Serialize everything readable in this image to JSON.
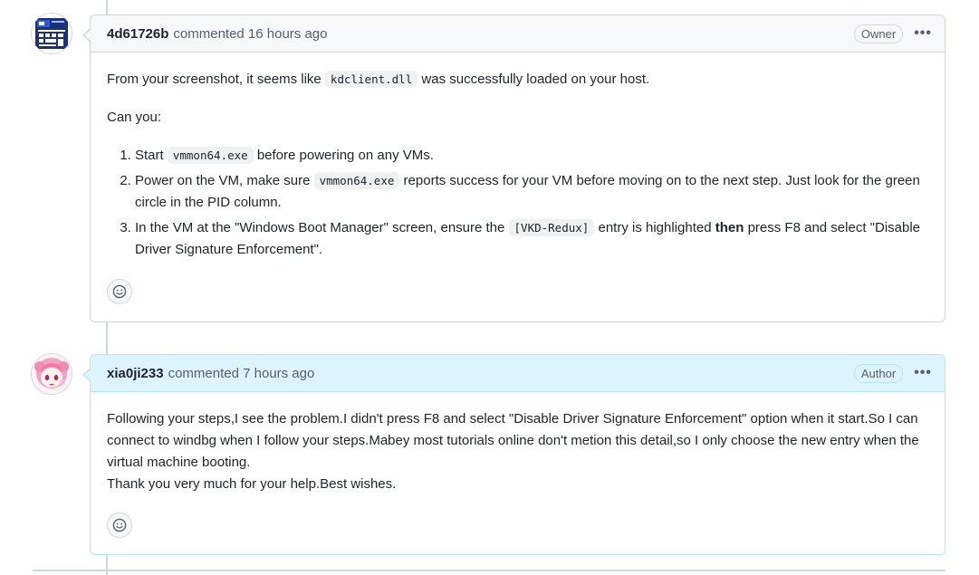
{
  "comments": [
    {
      "username": "4d61726b",
      "meta": "commented 16 hours ago",
      "badge": "Owner",
      "intro_before": "From your screenshot, it seems like ",
      "intro_code": "kdclient.dll",
      "intro_after": " was successfully loaded on your host.",
      "can_you": "Can you:",
      "steps": [
        {
          "a": "Start ",
          "code": "vmmon64.exe",
          "b": " before powering on any VMs."
        },
        {
          "a": "Power on the VM, make sure ",
          "code": "vmmon64.exe",
          "b": " reports success for your VM before moving on to the next step. Just look for the green circle in the PID column."
        },
        {
          "a": "In the VM at the \"Windows Boot Manager\" screen, ensure the ",
          "code": "[VKD-Redux]",
          "b": " entry is highlighted ",
          "bold": "then",
          "c": " press F8 and select \"Disable Driver Signature Enforcement\"."
        }
      ]
    },
    {
      "username": "xia0ji233",
      "meta": "commented 7 hours ago",
      "badge": "Author",
      "paragraph1": "Following your steps,I see the problem.I didn't press F8 and select \"Disable Driver Signature Enforcement\" option when it start.So I can connect to windbg when I follow your steps.Mabey most tutorials online don't metion this detail,so I only choose the new entry when the virtual machine booting.",
      "paragraph2": "Thank you very much for your help.Best wishes."
    }
  ],
  "icons": {
    "menu": "kebab-horizontal-icon",
    "reaction": "smiley-icon"
  },
  "colors": {
    "author_header_bg": "#ddf4ff",
    "author_border": "#b6e3ff",
    "header_bg": "#f6f8fa",
    "border": "#d0d7de"
  }
}
